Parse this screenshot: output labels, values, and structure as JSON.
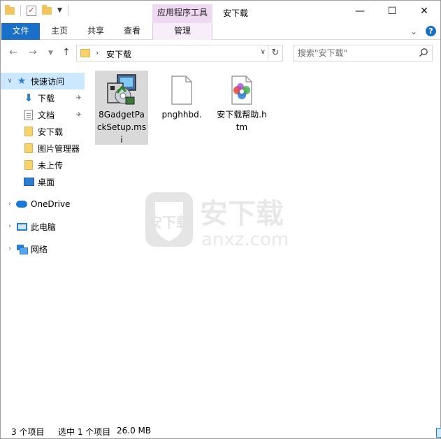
{
  "window": {
    "title": "安下载",
    "contextual_group_label": "应用程序工具",
    "controls": {
      "minimize": "—",
      "maximize": "☐",
      "close": "✕"
    }
  },
  "ribbon": {
    "tabs": [
      {
        "label": "文件"
      },
      {
        "label": "主页"
      },
      {
        "label": "共享"
      },
      {
        "label": "查看"
      },
      {
        "label": "管理"
      }
    ],
    "collapse": "⌄",
    "help": "?"
  },
  "address": {
    "crumb": "安下载",
    "search_placeholder": "搜索\"安下载\""
  },
  "navpane": {
    "items": [
      {
        "label": "快速访问",
        "icon": "star-icon"
      },
      {
        "label": "下载",
        "icon": "download-icon",
        "pinned": true
      },
      {
        "label": "文档",
        "icon": "document-icon",
        "pinned": true
      },
      {
        "label": "安下载",
        "icon": "folder-icon"
      },
      {
        "label": "图片管理器",
        "icon": "folder-icon"
      },
      {
        "label": "未上传",
        "icon": "folder-icon"
      },
      {
        "label": "桌面",
        "icon": "desktop-icon"
      },
      {
        "label": "OneDrive",
        "icon": "cloud-icon"
      },
      {
        "label": "此电脑",
        "icon": "computer-icon"
      },
      {
        "label": "网络",
        "icon": "network-icon"
      }
    ]
  },
  "files": [
    {
      "name": "8GadgetPackSetup.msi",
      "icon": "msi-installer-icon",
      "selected": true
    },
    {
      "name": "pnghhbd.",
      "icon": "blank-file-icon",
      "selected": false
    },
    {
      "name": "安下载帮助.htm",
      "icon": "htm-file-icon",
      "selected": false
    }
  ],
  "watermark": {
    "line1": "安下载",
    "line2": "anxz.com"
  },
  "status": {
    "count": "3 个项目",
    "selection": "选中 1 个项目",
    "size": "26.0 MB"
  }
}
